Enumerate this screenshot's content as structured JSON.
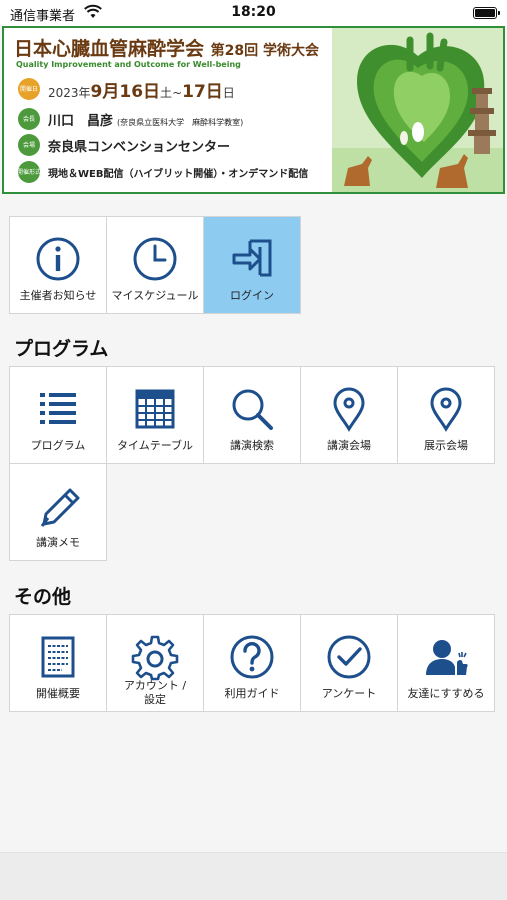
{
  "status_bar": {
    "carrier": "通信事業者",
    "time": "18:20"
  },
  "banner": {
    "title_main": "日本心臓血管麻酔学会",
    "title_sub": "第28回 学術大会",
    "subtitle": "Quality Improvement and Outcome for Well-being",
    "dates_label": "開催日",
    "dates_year": "2023年",
    "dates_start": "9月16日",
    "dates_start_day": "土",
    "dates_sep": "~",
    "dates_end": "17日",
    "dates_end_day": "日",
    "chair_label": "会長",
    "chair_name": "川口　昌彦",
    "chair_affiliation": "(奈良県立医科大学　麻酔科学教室)",
    "venue_label": "会場",
    "venue": "奈良県コンベンションセンター",
    "format_label": "開催形式",
    "format": "現地＆WEB配信（ハイブリット開催）・オンデマンド配信"
  },
  "top_menu": [
    {
      "label": "主催者お知らせ"
    },
    {
      "label": "マイスケジュール"
    },
    {
      "label": "ログイン"
    }
  ],
  "program_section": {
    "title": "プログラム",
    "items": [
      {
        "label": "プログラム"
      },
      {
        "label": "タイムテーブル"
      },
      {
        "label": "講演検索"
      },
      {
        "label": "講演会場"
      },
      {
        "label": "展示会場"
      },
      {
        "label": "講演メモ"
      }
    ]
  },
  "other_section": {
    "title": "その他",
    "items": [
      {
        "label": "開催概要"
      },
      {
        "label": "アカウント /\n設定"
      },
      {
        "label": "利用ガイド"
      },
      {
        "label": "アンケート"
      },
      {
        "label": "友達にすすめる"
      }
    ]
  },
  "colors": {
    "icon": "#1d4f8c",
    "active_tile": "#8dcbf1",
    "banner_border": "#2f8f3a",
    "banner_title": "#6a3a12"
  }
}
